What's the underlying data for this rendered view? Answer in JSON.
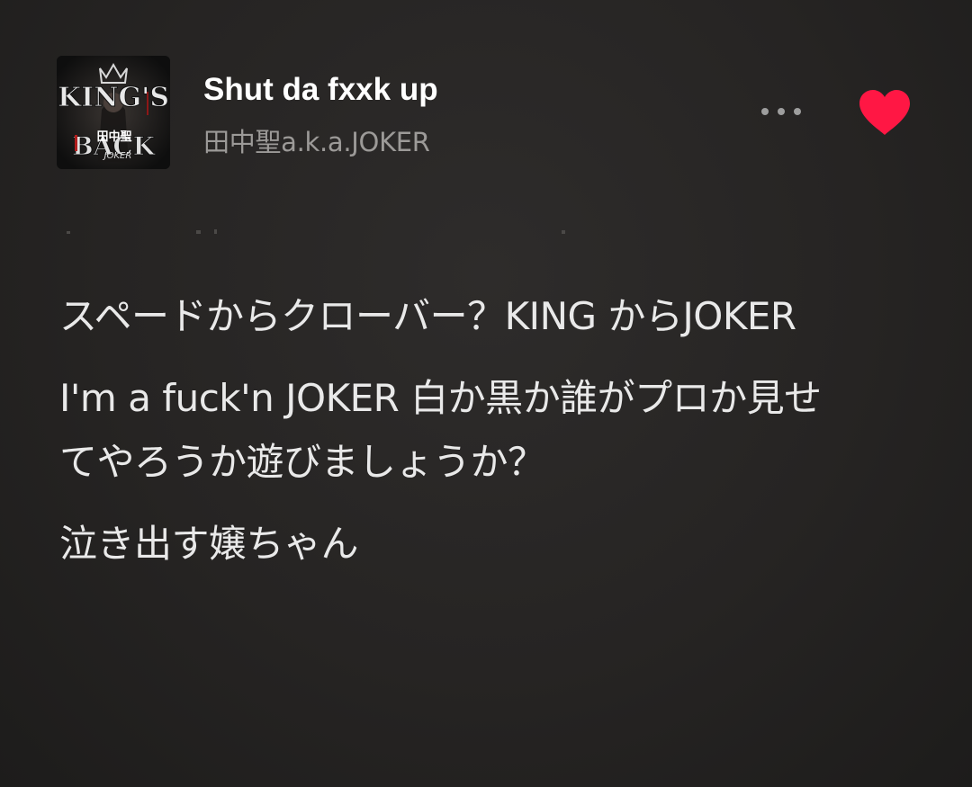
{
  "track": {
    "title": "Shut da fxxk up",
    "artist": "田中聖a.k.a.JOKER",
    "album_art_text_top": "KING'S",
    "album_art_text_bottom": "BACK",
    "album_art_text_artist": "田中聖",
    "album_art_text_joker": "JOKER"
  },
  "actions": {
    "more_icon": "more-horizontal-icon",
    "like_icon": "heart-icon",
    "like_color": "#ff1744",
    "liked": true
  },
  "lyrics": {
    "lines": [
      "スペードからクローバー？KING からJOKER",
      "I'm a fuck'n JOKER 白か黒か誰がプロか見せてやろうか遊びましょうか？",
      "泣き出す嬢ちゃん"
    ]
  },
  "colors": {
    "background": "#2a2827",
    "title": "#ffffff",
    "artist": "#9c9a98",
    "lyrics": "#e9e9e9"
  }
}
